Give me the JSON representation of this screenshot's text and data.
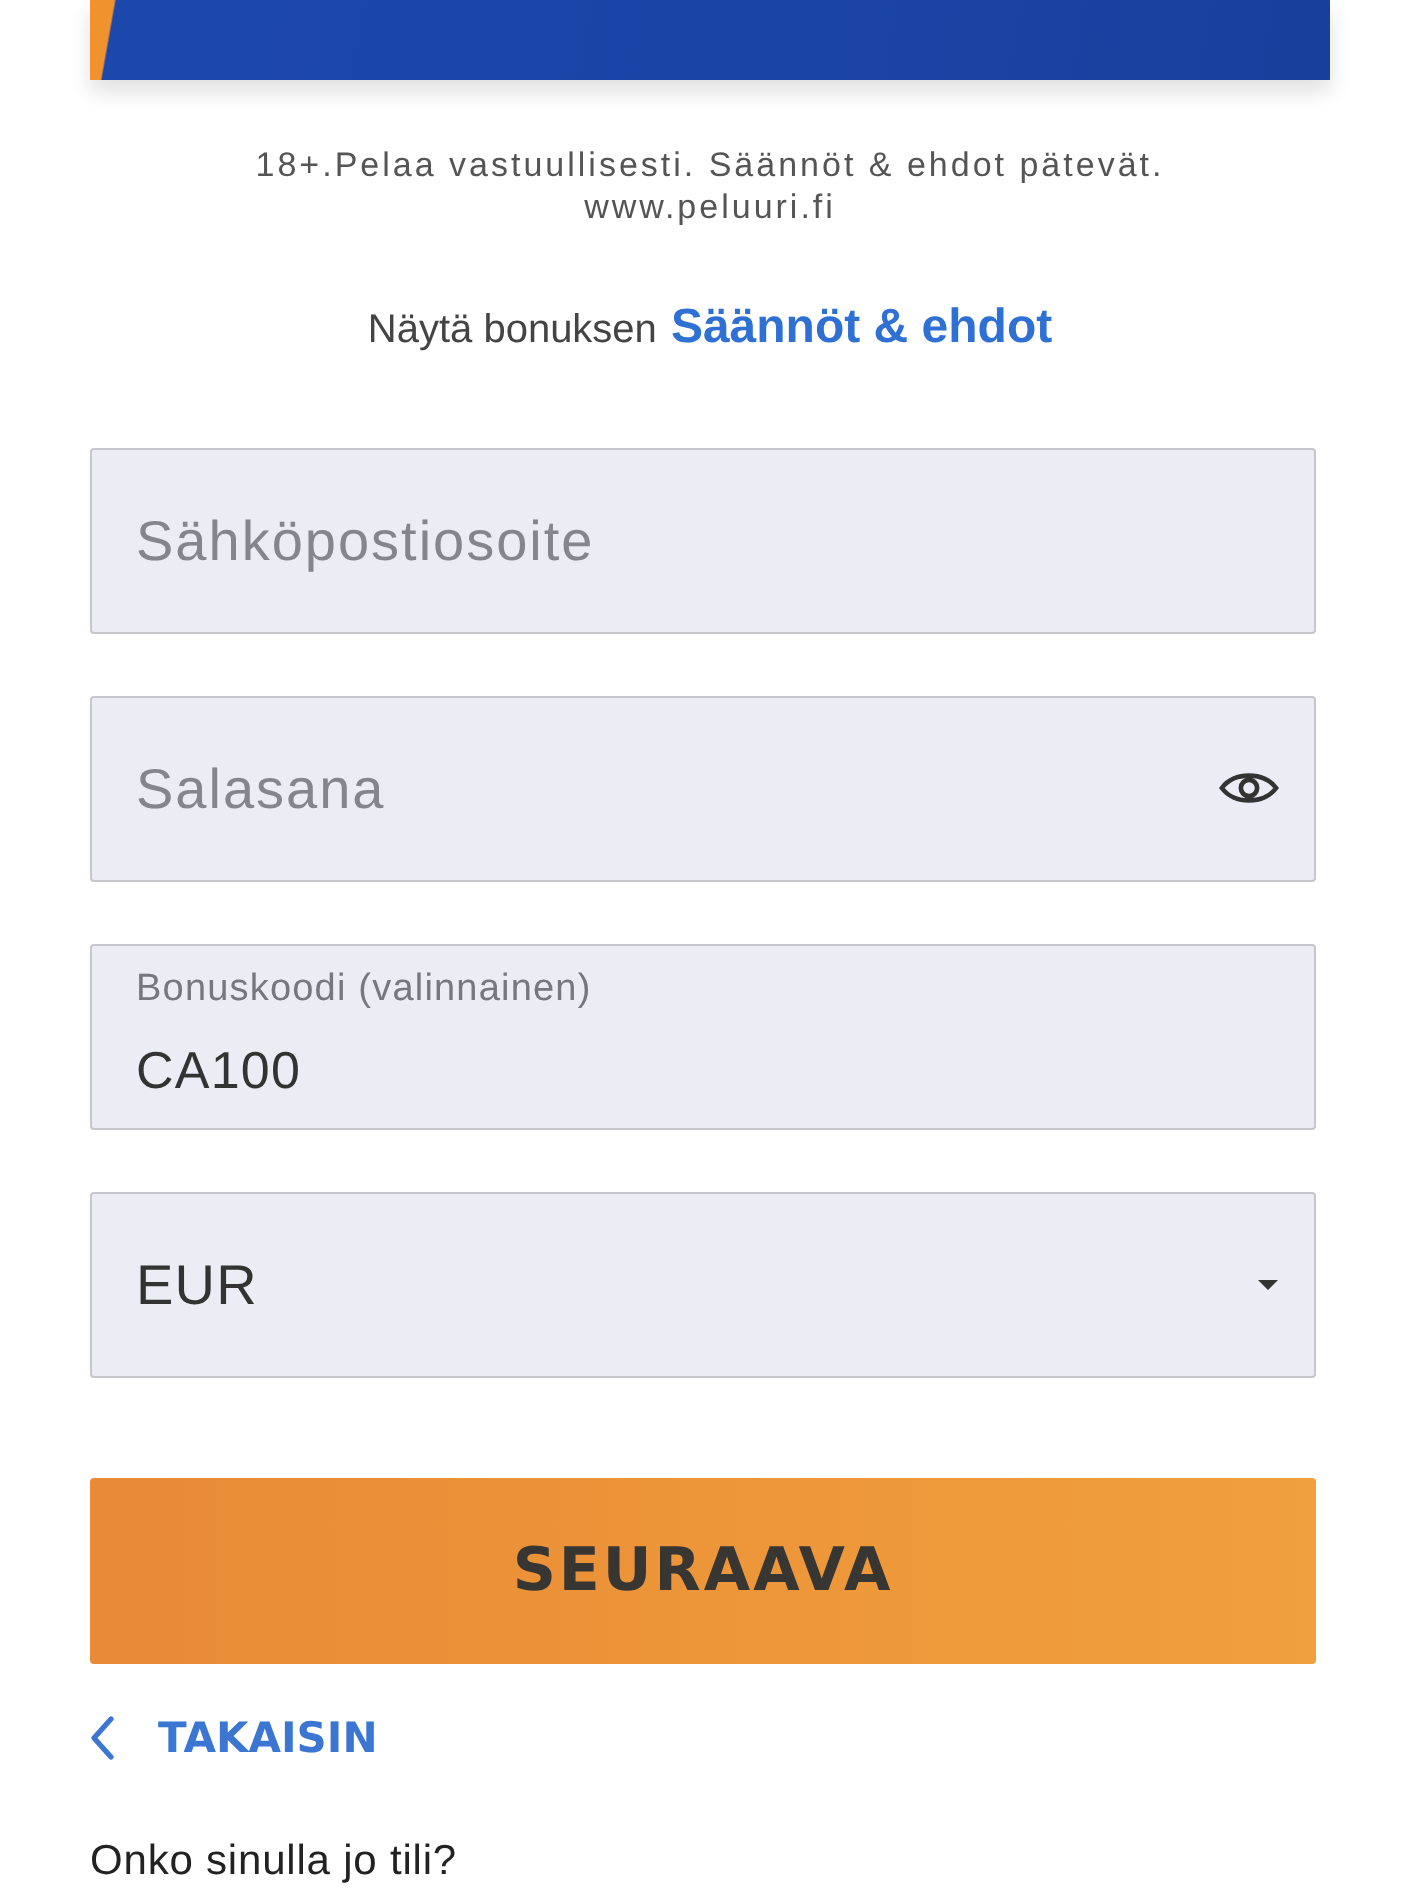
{
  "disclaimer": {
    "lines": [
      "18+.Pelaa vastuullisesti. Säännöt & ehdot pätevät.",
      "www.peluuri.fi"
    ]
  },
  "terms": {
    "text": "Näytä bonuksen",
    "link": "Säännöt & ehdot"
  },
  "fields": [
    {
      "kind": "text",
      "placeholder": "Sähköpostiosoite"
    },
    {
      "kind": "password",
      "placeholder": "Salasana"
    },
    {
      "kind": "floating",
      "label": "Bonuskoodi (valinnainen)",
      "value": "CA100"
    },
    {
      "kind": "select",
      "value": "EUR"
    }
  ],
  "next_button": "SEURAAVA",
  "back_link": "TAKAISIN",
  "login_prompt": "Onko sinulla jo tili?"
}
